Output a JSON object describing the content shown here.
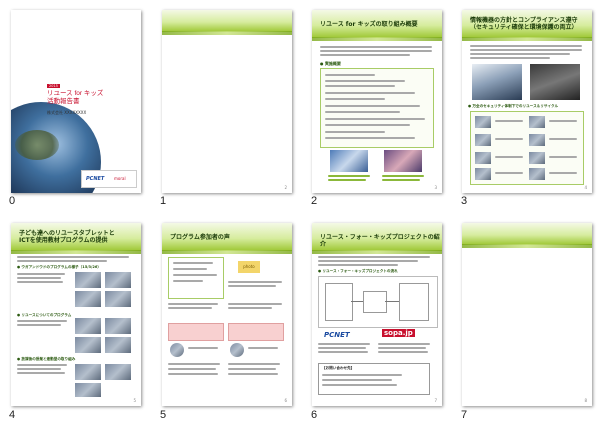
{
  "slides": [
    {
      "index": "0",
      "title_line1": "リユース for キッズ",
      "title_line2": "活動報告書",
      "author": "株式会社 XXXXXXXX",
      "badge": "2015",
      "logo1": "PCNET",
      "logo2": "moral"
    },
    {
      "index": "1",
      "page": "2"
    },
    {
      "index": "2",
      "header": "リユース for キッズの取り組み概要",
      "section": "● 実施概要",
      "page": "3"
    },
    {
      "index": "3",
      "header_line1": "情報機器の方針とコンプライアンス遵守",
      "header_line2": "（セキュリティ確保と環境保護の両立）",
      "section": "● 万全のセキュリティ体制下でのリユース＆リサイクル",
      "page": "4"
    },
    {
      "index": "4",
      "header_line1": "子ども達へのリユースタブレットと",
      "header_line2": "ICTを使用教材プログラムの提供",
      "section1": "● ウガアンドウドのプログラムの様子（15/3/26）",
      "section2": "● リユースについてのプログラム",
      "section3": "● 放課後の授業と連動型の取り組み",
      "page": "5"
    },
    {
      "index": "5",
      "header": "プログラム参加者の声",
      "badge": "photo",
      "page": "6"
    },
    {
      "index": "6",
      "header": "リユース・フォー・キッズプロジェクトの紹介",
      "section": "● リユース・フォー・キッズプロジェクトの流れ",
      "logo1": "PCNET",
      "logo2": "sopa.jp",
      "contact": "【お問い合わせ先】",
      "page": "7"
    },
    {
      "index": "7",
      "page": "8"
    }
  ],
  "colors": {
    "accent_green": "#8bb83a",
    "header_green": "#9dc632",
    "title_red": "#c8102e"
  }
}
